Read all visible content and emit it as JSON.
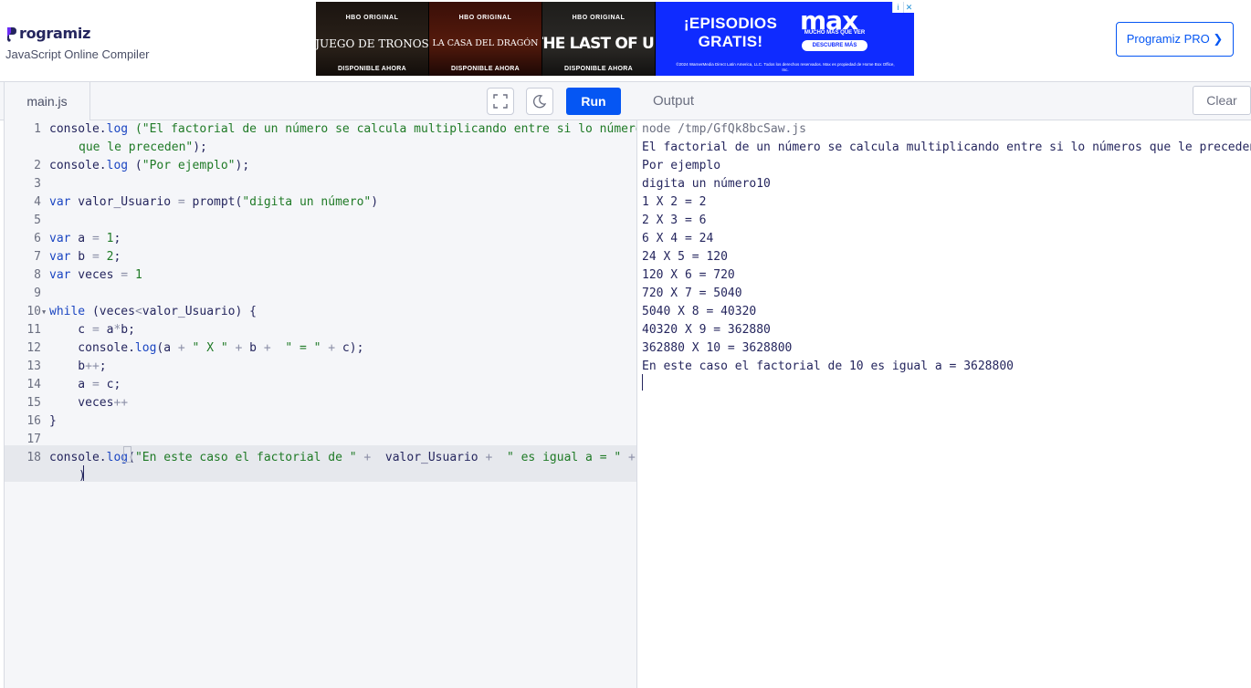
{
  "header": {
    "brand": "rogramiz",
    "brand_full": "Programiz",
    "subtitle": "JavaScript Online Compiler",
    "pro_button": "Programiz PRO ❯"
  },
  "ad": {
    "tiles": [
      {
        "badge": "HBO ORIGINAL",
        "show": "JUEGO DE TRONOS",
        "available": "DISPONIBLE AHORA"
      },
      {
        "badge": "HBO ORIGINAL",
        "show": "LA CASA DEL DRAGÓN",
        "available": "DISPONIBLE AHORA"
      },
      {
        "badge": "HBO ORIGINAL",
        "show": "THE LAST OF US",
        "available": "DISPONIBLE AHORA"
      }
    ],
    "promo": "¡EPISODIOS GRATIS!",
    "brand": "max",
    "tagline": "MUCHO MÁS QUE VER",
    "cta": "DESCUBRE MÁS",
    "legal": "©2024 WarnerMedia Direct Latin America, LLC. Todos los derechos reservados. Max es propiedad de Home Box Office, Inc.",
    "info_icon": "i",
    "close_icon": "✕"
  },
  "toolbar": {
    "file_tab": "main.js",
    "run": "Run",
    "output_label": "Output",
    "clear": "Clear"
  },
  "editor": {
    "line_numbers": [
      "1",
      "",
      "2",
      "3",
      "4",
      "5",
      "6",
      "7",
      "8",
      "9",
      "10",
      "11",
      "12",
      "13",
      "14",
      "15",
      "16",
      "17",
      "18",
      ""
    ]
  },
  "output": {
    "lines": [
      "node /tmp/GfQk8bcSaw.js",
      "El factorial de un número se calcula multiplicando entre si lo números que le preceden",
      "Por ejemplo",
      "digita un número10",
      "1 X 2 = 2",
      "2 X 3 = 6",
      "6 X 4 = 24",
      "24 X 5 = 120",
      "120 X 6 = 720",
      "720 X 7 = 5040",
      "5040 X 8 = 40320",
      "40320 X 9 = 362880",
      "362880 X 10 = 3628800",
      "En este caso el factorial de 10 es igual a = 3628800"
    ]
  },
  "colors": {
    "accent": "#0556f3",
    "brand_dark": "#25265e",
    "keyword": "#1b46c2",
    "string": "#1f7a26"
  }
}
